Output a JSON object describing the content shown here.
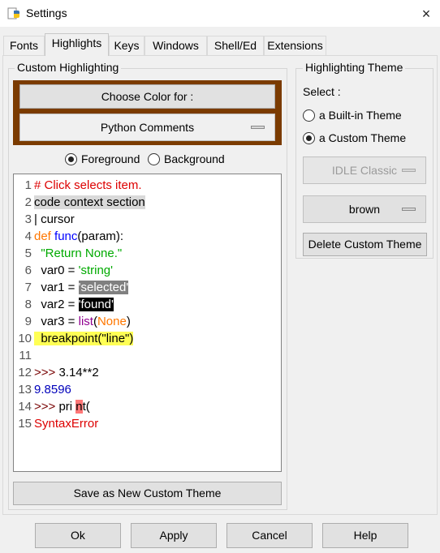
{
  "window": {
    "title": "Settings",
    "close_icon": "×"
  },
  "tabs": [
    "Fonts",
    "Highlights",
    "Keys",
    "Windows",
    "Shell/Ed",
    "Extensions"
  ],
  "custom": {
    "group_label": "Custom Highlighting",
    "choose_color": "Choose Color for :",
    "element": "Python Comments",
    "frame_color": "#7b3b00",
    "fg_label": "Foreground",
    "bg_label": "Background",
    "save_button": "Save as New Custom Theme"
  },
  "theme": {
    "group_label": "Highlighting Theme",
    "select_label": "Select :",
    "builtin_label": "a Built-in Theme",
    "custom_label": "a Custom Theme",
    "builtin_value": "IDLE Classic",
    "custom_value": "brown",
    "delete_button": "Delete Custom Theme"
  },
  "sample": {
    "l1": {
      "n": "1",
      "comment": "# Click selects item."
    },
    "l2": {
      "n": "2",
      "text": "code context section"
    },
    "l3": {
      "n": "3",
      "text": "| cursor"
    },
    "l4": {
      "n": "4",
      "kw": "def",
      "sp": " ",
      "def": "func",
      "rest": "(param):"
    },
    "l5": {
      "n": "5",
      "indent": "  ",
      "str": "\"Return None.\""
    },
    "l6": {
      "n": "6",
      "pre": "  var0 = ",
      "str": "'string'"
    },
    "l7": {
      "n": "7",
      "pre": "  var1 = ",
      "sel": "'selected'"
    },
    "l8": {
      "n": "8",
      "pre": "  var2 = ",
      "found": "'found'"
    },
    "l9": {
      "n": "9",
      "pre": "  var3 = ",
      "builtin": "list",
      "p1": "(",
      "kw": "None",
      "p2": ")"
    },
    "l10": {
      "n": "10",
      "bp": "  breakpoint(\"line\")"
    },
    "l11": {
      "n": "11"
    },
    "l12": {
      "n": "12",
      "prompt": ">>>",
      "rest": " 3.14**2"
    },
    "l13": {
      "n": "13",
      "stdout": "9.8596"
    },
    "l14": {
      "n": "14",
      "prompt": ">>>",
      "pre": " pri ",
      "err": "n",
      "post": "t("
    },
    "l15": {
      "n": "15",
      "stderr": "SyntaxError"
    }
  },
  "buttons": {
    "ok": "Ok",
    "apply": "Apply",
    "cancel": "Cancel",
    "help": "Help"
  }
}
